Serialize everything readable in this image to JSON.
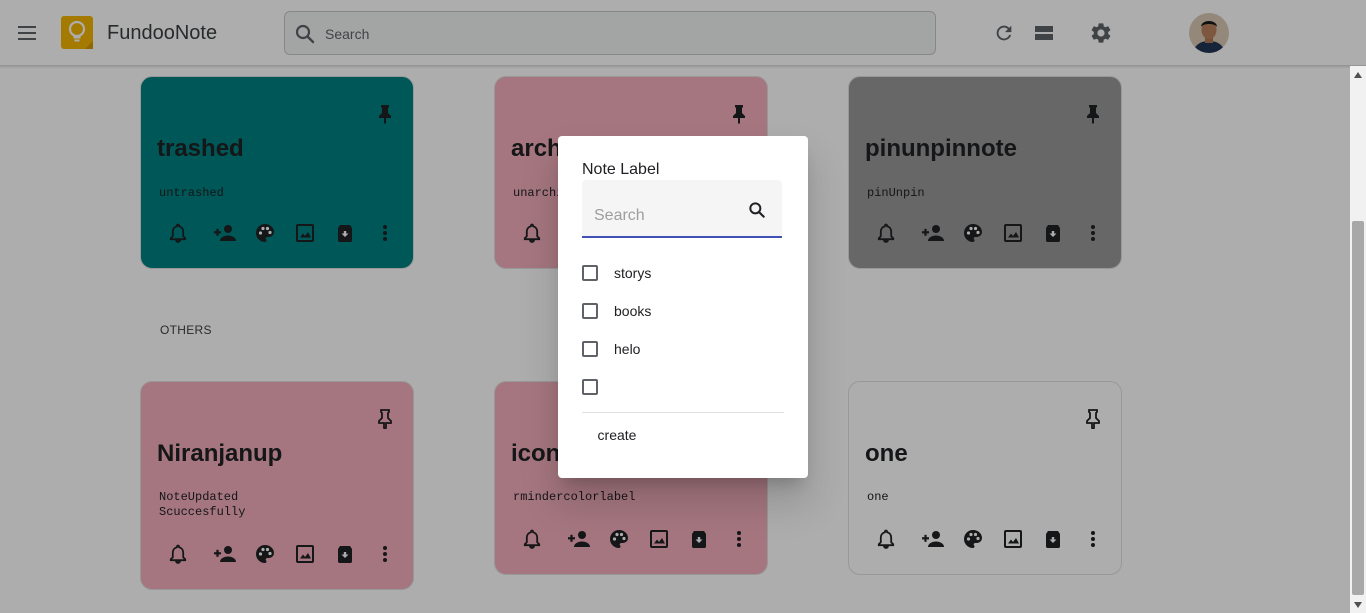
{
  "app": {
    "title": "FundooNote",
    "menu_icon": "menu-icon",
    "logo_icon": "lightbulb-logo-icon"
  },
  "search": {
    "placeholder": "Search"
  },
  "header_icons": [
    "refresh-icon",
    "list-view-icon",
    "settings-icon"
  ],
  "colors": {
    "teal": "#008080",
    "pink": "#f4aebc",
    "gray": "#999999",
    "white": "#ffffff",
    "accent": "#3f51b5"
  },
  "pinned_notes": [
    {
      "title": "trashed",
      "body": "untrashed",
      "color": "#008080"
    },
    {
      "title": "archived",
      "body": "unarchived",
      "color": "#f4aebc"
    },
    {
      "title": "pinunpinnote",
      "body": "pinUnpin",
      "color": "#999999"
    }
  ],
  "section": {
    "others_label": "OTHERS"
  },
  "other_notes": [
    {
      "title": "Niranjanup",
      "body": "NoteUpdated Scuccesfully",
      "color": "#f4aebc"
    },
    {
      "title": "icon",
      "body": "rmindercolorlabel",
      "color": "#f4aebc"
    },
    {
      "title": "one",
      "body": "one",
      "color": "#ffffff"
    }
  ],
  "note_actions": [
    "reminder-icon",
    "collaborator-icon",
    "palette-icon",
    "image-icon",
    "archive-icon",
    "more-icon"
  ],
  "dialog": {
    "title": "Note Label",
    "search_placeholder": "Search",
    "labels": [
      {
        "name": "storys",
        "checked": false
      },
      {
        "name": "books",
        "checked": false
      },
      {
        "name": "helo",
        "checked": false
      },
      {
        "name": "",
        "checked": false
      }
    ],
    "create_label": "create"
  }
}
